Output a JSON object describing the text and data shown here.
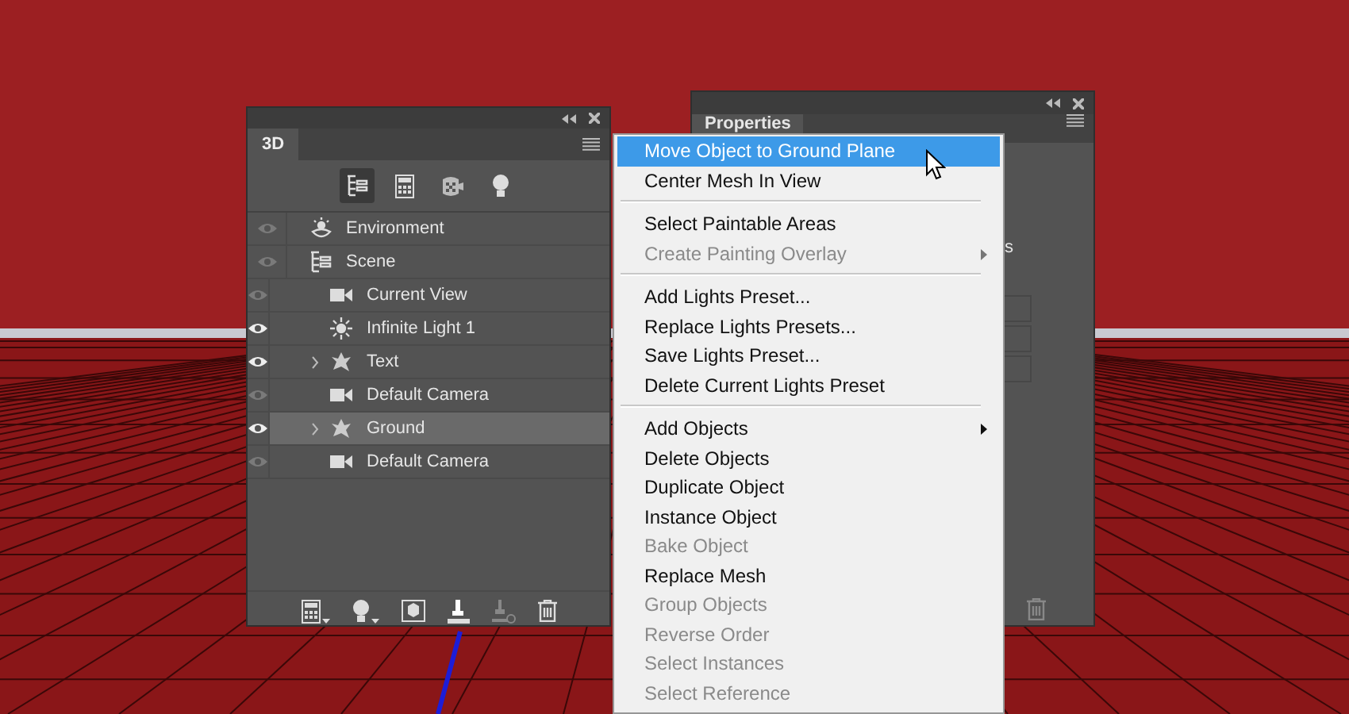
{
  "panel_3d": {
    "tab": "3D",
    "filters": [
      {
        "kind": "scene",
        "selected": true
      },
      {
        "kind": "mesh",
        "selected": false
      },
      {
        "kind": "material",
        "selected": false
      },
      {
        "kind": "light",
        "selected": false
      }
    ],
    "tree": [
      {
        "label": "Environment",
        "kind": "environment",
        "visible": false,
        "selected": false
      },
      {
        "label": "Scene",
        "kind": "scene",
        "visible": false,
        "selected": false,
        "children": [
          {
            "label": "Current View",
            "kind": "camera",
            "visible": false,
            "selected": false
          },
          {
            "label": "Infinite Light 1",
            "kind": "light",
            "visible": true,
            "selected": false
          },
          {
            "label": "Text",
            "kind": "mesh",
            "visible": true,
            "selected": false,
            "expanded": false
          },
          {
            "label": "Default Camera",
            "kind": "camera",
            "visible": false,
            "selected": false
          },
          {
            "label": "Ground",
            "kind": "mesh",
            "visible": true,
            "selected": true,
            "expanded": false
          },
          {
            "label": "Default Camera",
            "kind": "camera",
            "visible": false,
            "selected": false
          }
        ]
      }
    ],
    "bottom_tools": [
      {
        "kind": "mesh-menu"
      },
      {
        "kind": "light-menu"
      },
      {
        "kind": "render"
      },
      {
        "kind": "drop"
      },
      {
        "kind": "drop-off"
      },
      {
        "kind": "delete"
      }
    ]
  },
  "properties_panel": {
    "tab": "Properties",
    "fragment": "s"
  },
  "context_menu": {
    "groups": [
      [
        {
          "label": "Move Object to Ground Plane",
          "disabled": false,
          "selected": true,
          "submenu": false
        },
        {
          "label": "Center Mesh In View",
          "disabled": false,
          "selected": false,
          "submenu": false
        }
      ],
      [
        {
          "label": "Select Paintable Areas",
          "disabled": false,
          "selected": false,
          "submenu": false
        },
        {
          "label": "Create Painting Overlay",
          "disabled": true,
          "selected": false,
          "submenu": true
        }
      ],
      [
        {
          "label": "Add Lights Preset...",
          "disabled": false,
          "selected": false,
          "submenu": false
        },
        {
          "label": "Replace Lights Presets...",
          "disabled": false,
          "selected": false,
          "submenu": false
        },
        {
          "label": "Save Lights Preset...",
          "disabled": false,
          "selected": false,
          "submenu": false
        },
        {
          "label": "Delete Current Lights Preset",
          "disabled": false,
          "selected": false,
          "submenu": false
        }
      ],
      [
        {
          "label": "Add Objects",
          "disabled": false,
          "selected": false,
          "submenu": true
        },
        {
          "label": "Delete Objects",
          "disabled": false,
          "selected": false,
          "submenu": false
        },
        {
          "label": "Duplicate Object",
          "disabled": false,
          "selected": false,
          "submenu": false
        },
        {
          "label": "Instance Object",
          "disabled": false,
          "selected": false,
          "submenu": false
        },
        {
          "label": "Bake Object",
          "disabled": true,
          "selected": false,
          "submenu": false
        },
        {
          "label": "Replace Mesh",
          "disabled": false,
          "selected": false,
          "submenu": false
        },
        {
          "label": "Group Objects",
          "disabled": true,
          "selected": false,
          "submenu": false
        },
        {
          "label": "Reverse Order",
          "disabled": true,
          "selected": false,
          "submenu": false
        },
        {
          "label": "Select Instances",
          "disabled": true,
          "selected": false,
          "submenu": false
        },
        {
          "label": "Select Reference",
          "disabled": true,
          "selected": false,
          "submenu": false
        }
      ]
    ]
  }
}
